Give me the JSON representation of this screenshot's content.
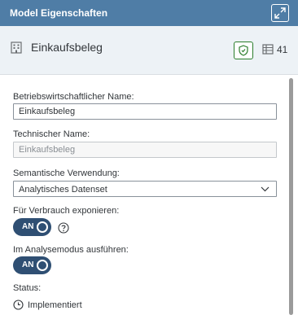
{
  "header": {
    "title": "Model Eigenschaften",
    "expand_icon": "expand-icon"
  },
  "object": {
    "icon": "building-icon",
    "title": "Einkaufsbeleg",
    "shield_icon": "shield-icon",
    "shield_color": "#2b7d2b",
    "table_icon": "table-icon",
    "count": "41"
  },
  "form": {
    "business_name": {
      "label": "Betriebswirtschaftlicher Name:",
      "value": "Einkaufsbeleg"
    },
    "technical_name": {
      "label": "Technischer Name:",
      "value": "Einkaufsbeleg"
    },
    "semantic_usage": {
      "label": "Semantische Verwendung:",
      "value": "Analytisches Datenset"
    },
    "expose_for_consumption": {
      "label": "Für Verbrauch exponieren:",
      "switch_text": "AN",
      "help_icon": "help-icon"
    },
    "run_in_analysis_mode": {
      "label": "Im Analysemodus ausführen:",
      "switch_text": "AN"
    },
    "status": {
      "label": "Status:",
      "value": "Implementiert",
      "icon": "clock-icon"
    }
  },
  "colors": {
    "header_bg": "#4f7da6",
    "subheader_bg": "#edf2f6",
    "switch_on": "#2f4f73"
  }
}
